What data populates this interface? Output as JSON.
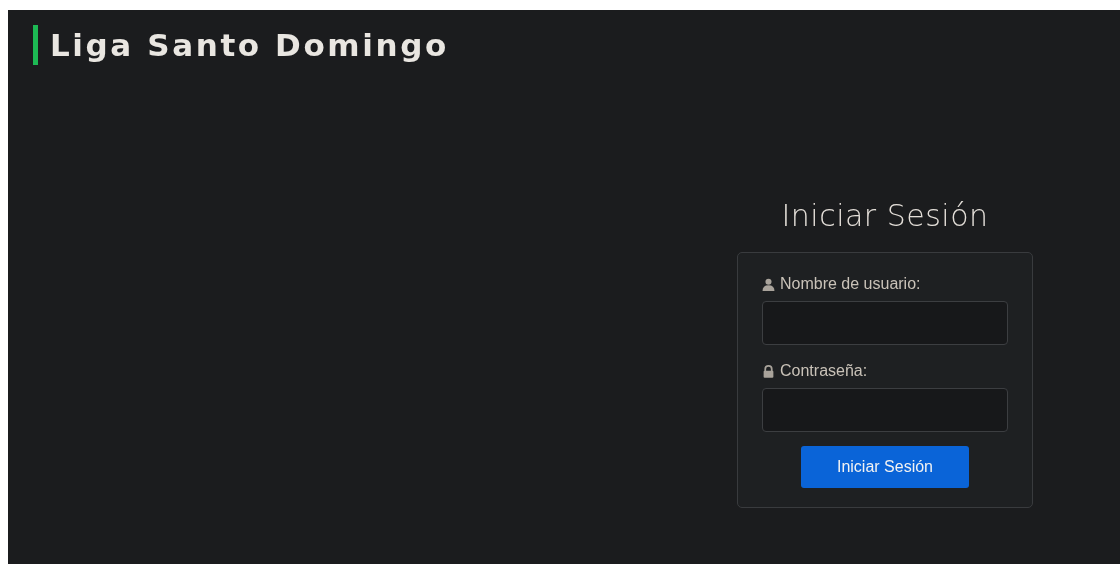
{
  "header": {
    "title": "Liga Santo Domingo"
  },
  "login": {
    "title": "Iniciar Sesión",
    "fields": [
      {
        "kind": "user",
        "label": "Nombre de usuario:"
      },
      {
        "kind": "password",
        "label": "Contraseña:"
      }
    ],
    "submit": "Iniciar Sesión"
  }
}
